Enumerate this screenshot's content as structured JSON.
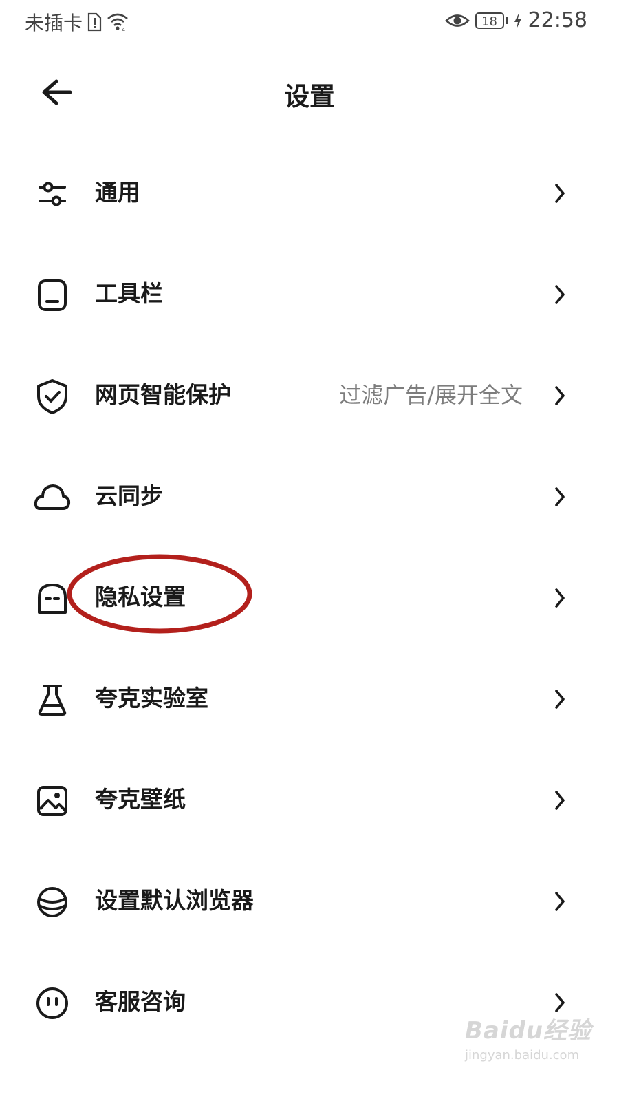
{
  "status_bar": {
    "carrier": "未插卡",
    "battery": "18",
    "time": "22:58"
  },
  "header": {
    "title": "设置",
    "back_icon": "back-arrow-icon"
  },
  "items": [
    {
      "label": "通用",
      "sub": "",
      "icon": "sliders-icon"
    },
    {
      "label": "工具栏",
      "sub": "",
      "icon": "toolbar-icon"
    },
    {
      "label": "网页智能保护",
      "sub": "过滤广告/展开全文",
      "icon": "shield-check-icon"
    },
    {
      "label": "云同步",
      "sub": "",
      "icon": "cloud-icon"
    },
    {
      "label": "隐私设置",
      "sub": "",
      "icon": "privacy-mask-icon"
    },
    {
      "label": "夸克实验室",
      "sub": "",
      "icon": "flask-icon"
    },
    {
      "label": "夸克壁纸",
      "sub": "",
      "icon": "image-icon"
    },
    {
      "label": "设置默认浏览器",
      "sub": "",
      "icon": "planet-icon"
    },
    {
      "label": "客服咨询",
      "sub": "",
      "icon": "support-face-icon"
    }
  ],
  "annotation": {
    "highlighted_item": "隐私设置",
    "color": "#b3201c"
  },
  "watermark": {
    "main": "Baidu经验",
    "sub": "jingyan.baidu.com"
  }
}
